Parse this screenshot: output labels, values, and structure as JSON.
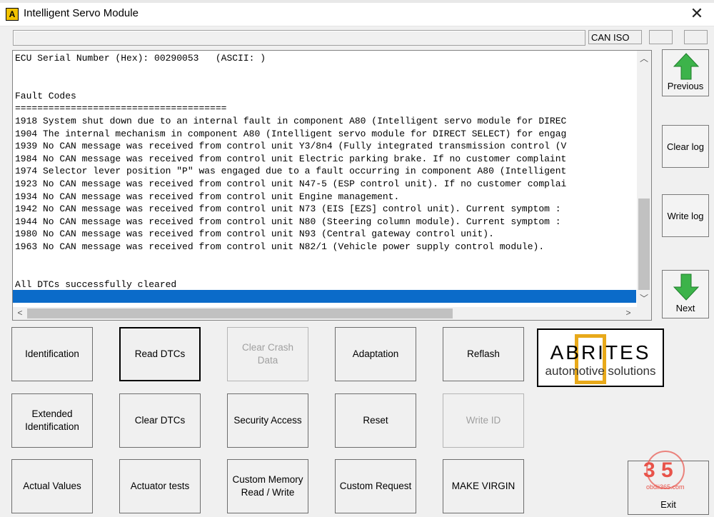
{
  "window": {
    "app_icon_letter": "A",
    "title": "Intelligent Servo Module",
    "close_symbol": "✕"
  },
  "status": {
    "protocol": "CAN ISO"
  },
  "log": {
    "lines": [
      "ECU Serial Number (Hex): 00290053   (ASCII: )",
      "",
      "",
      "Fault Codes",
      "======================================",
      "1918 System shut down due to an internal fault in component A80 (Intelligent servo module for DIREC",
      "1904 The internal mechanism in component A80 (Intelligent servo module for DIRECT SELECT) for engag",
      "1939 No CAN message was received from control unit Y3/8n4 (Fully integrated transmission control (V",
      "1984 No CAN message was received from control unit Electric parking brake. If no customer complaint",
      "1974 Selector lever position \"P\" was engaged due to a fault occurring in component A80 (Intelligent",
      "1923 No CAN message was received from control unit N47-5 (ESP control unit). If no customer complai",
      "1934 No CAN message was received from control unit Engine management.",
      "1942 No CAN message was received from control unit N73 (EIS [EZS] control unit). Current symptom :",
      "1944 No CAN message was received from control unit N80 (Steering column module). Current symptom :",
      "1980 No CAN message was received from control unit N93 (Central gateway control unit).",
      "1963 No CAN message was received from control unit N82/1 (Vehicle power supply control module).",
      "",
      "",
      "All DTCs successfully cleared"
    ]
  },
  "nav": {
    "previous": "Previous",
    "clear_log": "Clear log",
    "write_log": "Write log",
    "next": "Next",
    "arrow_color": "#3cb34a"
  },
  "buttons": {
    "identification": "Identification",
    "read_dtcs": "Read DTCs",
    "clear_crash_data": "Clear Crash Data",
    "adaptation": "Adaptation",
    "reflash": "Reflash",
    "extended_identification": "Extended Identification",
    "clear_dtcs": "Clear DTCs",
    "security_access": "Security Access",
    "reset": "Reset",
    "write_id": "Write ID",
    "actual_values": "Actual Values",
    "actuator_tests": "Actuator tests",
    "custom_memory": "Custom Memory Read / Write",
    "custom_request": "Custom Request",
    "make_virgin": "MAKE VIRGIN",
    "exit": "Exit"
  },
  "logo": {
    "brand": "ABRITES",
    "tagline": "automotive solutions",
    "accent": "#e8a91a"
  },
  "watermark": {
    "text": "3 5",
    "site": "obdii365.com",
    "color": "#e8534a"
  }
}
